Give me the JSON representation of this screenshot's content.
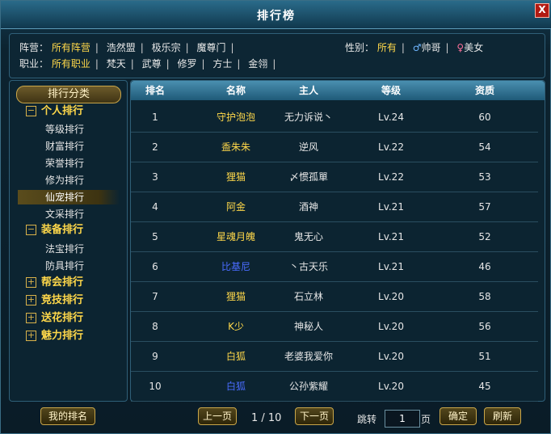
{
  "window": {
    "title": "排行榜",
    "close_label": "X"
  },
  "filters": {
    "camp_label": "阵营：",
    "camps": [
      "所有阵营",
      "浩然盟",
      "极乐宗",
      "魔尊门"
    ],
    "gender_label": "性别：",
    "gender_all": "所有",
    "male_symbol": "♂",
    "male_label": "帅哥",
    "female_symbol": "♀",
    "female_label": "美女",
    "job_label": "职业：",
    "jobs": [
      "所有职业",
      "梵天",
      "武尊",
      "修罗",
      "方士",
      "金翎"
    ]
  },
  "sidebar": {
    "header": "排行分类",
    "groups": [
      {
        "toggle": "−",
        "label": "个人排行",
        "items": [
          "等级排行",
          "财富排行",
          "荣誉排行",
          "修为排行",
          "仙宠排行",
          "文采排行"
        ]
      },
      {
        "toggle": "−",
        "label": "装备排行",
        "items": [
          "法宝排行",
          "防具排行"
        ]
      },
      {
        "toggle": "+",
        "label": "帮会排行"
      },
      {
        "toggle": "+",
        "label": "竞技排行"
      },
      {
        "toggle": "+",
        "label": "送花排行"
      },
      {
        "toggle": "+",
        "label": "魅力排行"
      }
    ],
    "selected": "仙宠排行"
  },
  "table": {
    "headers": [
      "排名",
      "名称",
      "主人",
      "等级",
      "资质"
    ],
    "rows": [
      {
        "rank": "1",
        "name": "守护泡泡",
        "owner": "无力诉说丶",
        "level": "Lv.24",
        "aptitude": "60",
        "color": "#ffd84a"
      },
      {
        "rank": "2",
        "name": "盉朱朱",
        "owner": "逆风",
        "level": "Lv.22",
        "aptitude": "54",
        "color": "#ffd84a"
      },
      {
        "rank": "3",
        "name": "狸猫",
        "owner": "〆惯孤單",
        "level": "Lv.22",
        "aptitude": "53",
        "color": "#ffd84a"
      },
      {
        "rank": "4",
        "name": "阿金",
        "owner": "酒神",
        "level": "Lv.21",
        "aptitude": "57",
        "color": "#ffd84a"
      },
      {
        "rank": "5",
        "name": "星魂月魄",
        "owner": "鬼无心",
        "level": "Lv.21",
        "aptitude": "52",
        "color": "#ffd84a"
      },
      {
        "rank": "6",
        "name": "比基尼",
        "owner": "丶古天乐",
        "level": "Lv.21",
        "aptitude": "46",
        "color": "#4a6cff"
      },
      {
        "rank": "7",
        "name": "狸猫",
        "owner": "石立林",
        "level": "Lv.20",
        "aptitude": "58",
        "color": "#ffd84a"
      },
      {
        "rank": "8",
        "name": "K少",
        "owner": "神秘人",
        "level": "Lv.20",
        "aptitude": "56",
        "color": "#ffd84a"
      },
      {
        "rank": "9",
        "name": "白狐",
        "owner": "老婆我爱你",
        "level": "Lv.20",
        "aptitude": "51",
        "color": "#ffd84a"
      },
      {
        "rank": "10",
        "name": "白狐",
        "owner": "公孙紫耀",
        "level": "Lv.20",
        "aptitude": "45",
        "color": "#4a6cff"
      }
    ]
  },
  "footer": {
    "my_rank": "我的排名",
    "prev": "上一页",
    "page_info": "1 / 10",
    "next": "下一页",
    "jump_label": "跳转",
    "jump_value": "1",
    "page_unit": "页",
    "confirm": "确定",
    "refresh": "刷新"
  }
}
